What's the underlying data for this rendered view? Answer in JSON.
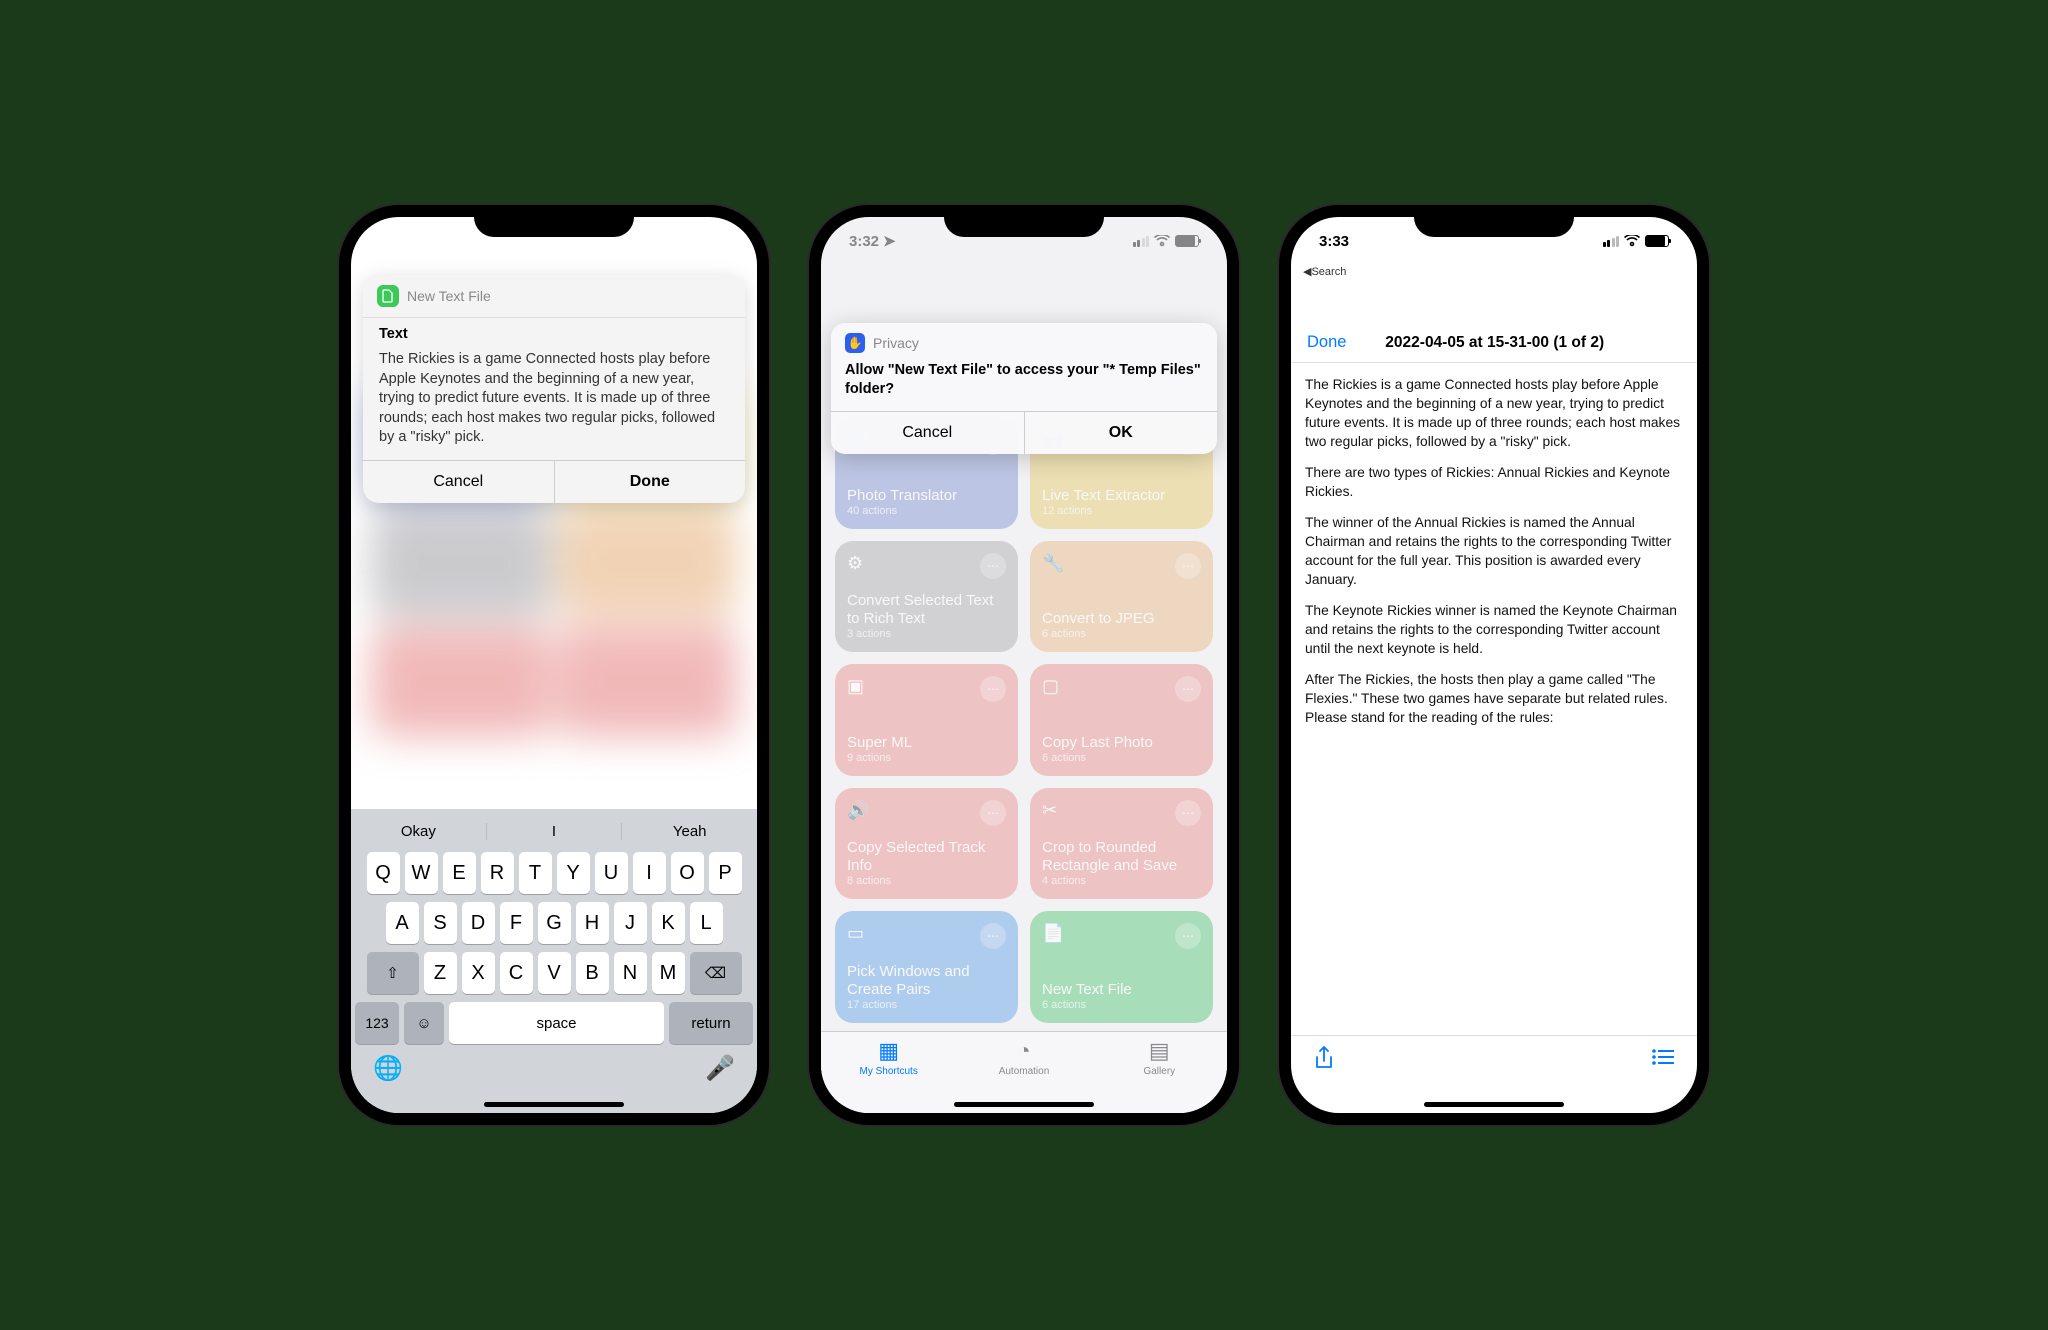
{
  "phone1": {
    "card": {
      "app_name": "New Text File",
      "label": "Text",
      "content": "The Rickies is a game Connected hosts play before Apple Keynotes and the beginning of a new year, trying to predict future events. It is made up of three rounds; each host makes two regular picks, followed by a \"risky\" pick.",
      "cancel": "Cancel",
      "done": "Done"
    },
    "keyboard": {
      "suggestions": [
        "Okay",
        "I",
        "Yeah"
      ],
      "row1": [
        "Q",
        "W",
        "E",
        "R",
        "T",
        "Y",
        "U",
        "I",
        "O",
        "P"
      ],
      "row2": [
        "A",
        "S",
        "D",
        "F",
        "G",
        "H",
        "J",
        "K",
        "L"
      ],
      "row3": [
        "Z",
        "X",
        "C",
        "V",
        "B",
        "N",
        "M"
      ],
      "num_key": "123",
      "space": "space",
      "return_key": "return"
    }
  },
  "phone2": {
    "time": "3:32",
    "alert": {
      "title": "Privacy",
      "question": "Allow \"New Text File\" to access your \"* Temp Files\" folder?",
      "cancel": "Cancel",
      "ok": "OK"
    },
    "tiles": [
      {
        "name": "Photo Translator",
        "sub": "40 actions",
        "color": "#7a8fd0"
      },
      {
        "name": "Live Text Extractor",
        "sub": "12 actions",
        "color": "#e4c766"
      },
      {
        "name": "Convert Selected Text to Rich Text",
        "sub": "3 actions",
        "color": "#a8a8ad"
      },
      {
        "name": "Convert to JPEG",
        "sub": "6 actions",
        "color": "#e8b583"
      },
      {
        "name": "Super ML",
        "sub": "9 actions",
        "color": "#e88a8a"
      },
      {
        "name": "Copy Last Photo",
        "sub": "6 actions",
        "color": "#e88a8a"
      },
      {
        "name": "Copy Selected Track Info",
        "sub": "8 actions",
        "color": "#e88a8a"
      },
      {
        "name": "Crop to Rounded Rectangle and Save",
        "sub": "4 actions",
        "color": "#e88a8a"
      },
      {
        "name": "Pick Windows and Create Pairs",
        "sub": "17 actions",
        "color": "#5b9de8"
      },
      {
        "name": "New Text File",
        "sub": "6 actions",
        "color": "#4bc470"
      }
    ],
    "tabs": {
      "shortcuts": "My Shortcuts",
      "automation": "Automation",
      "gallery": "Gallery"
    }
  },
  "phone3": {
    "time": "3:33",
    "back": "Search",
    "done": "Done",
    "title": "2022-04-05 at 15-31-00 (1 of 2)",
    "paragraphs": [
      "The Rickies is a game Connected hosts play before Apple Keynotes and the beginning of a new year, trying to predict future events. It is made up of three rounds; each host makes two regular picks, followed by a \"risky\" pick.",
      "There are two types of Rickies: Annual Rickies and Keynote Rickies.",
      "The winner of the Annual Rickies is named the Annual Chairman and retains the rights to the corresponding Twitter account for the full year. This position is awarded every January.",
      "The Keynote Rickies winner is named the Keynote Chairman and retains the rights to the corresponding Twitter account until the next keynote is held.",
      "After The Rickies, the hosts then play a game called \"The Flexies.\" These two games have separate but related rules. Please stand for the reading of the rules:"
    ]
  }
}
